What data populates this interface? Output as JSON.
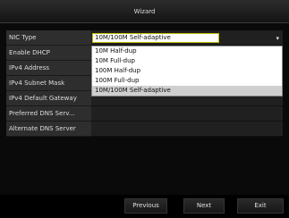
{
  "window": {
    "title": "Wizard"
  },
  "form": {
    "labels": [
      "NIC Type",
      "Enable DHCP",
      "IPv4 Address",
      "IPv4 Subnet Mask",
      "IPv4 Default Gateway",
      "Preferred DNS Serv...",
      "Alternate DNS Server"
    ],
    "nic_type_value": "10M/100M Self-adaptive",
    "nic_arrow_icon": "chevron-down-icon"
  },
  "dropdown": {
    "options": [
      "10M Half-dup",
      "10M Full-dup",
      "100M Half-dup",
      "100M Full-dup",
      "10M/100M Self-adaptive"
    ],
    "selected": "10M/100M Self-adaptive"
  },
  "buttons": {
    "previous": "Previous",
    "next": "Next",
    "exit": "Exit"
  }
}
